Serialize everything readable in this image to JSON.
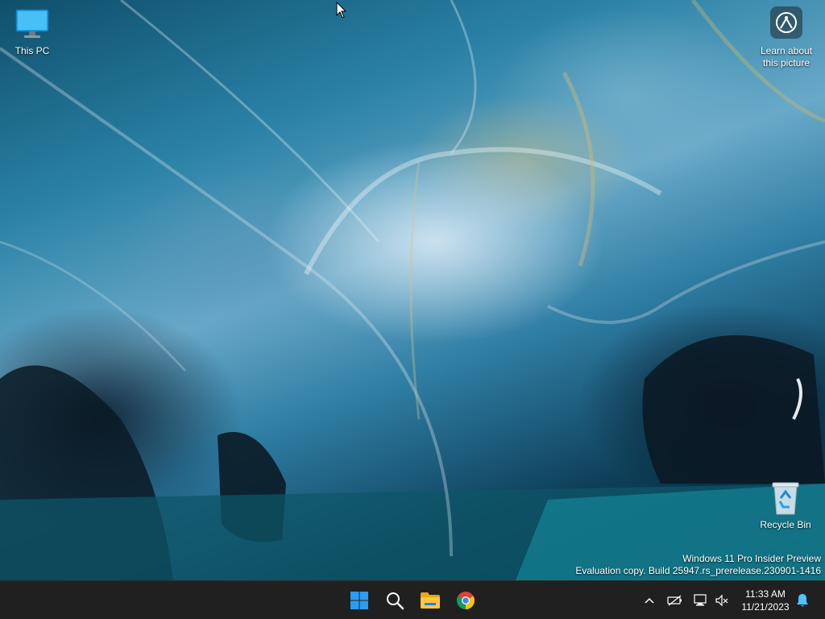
{
  "desktop": {
    "icons": [
      {
        "label": "This PC",
        "icon": "computer-monitor-icon"
      },
      {
        "label": "Learn about this picture",
        "icon": "learn-about-picture-icon"
      },
      {
        "label": "Recycle Bin",
        "icon": "recycle-bin-icon"
      }
    ],
    "watermark": {
      "line1": "Windows 11 Pro Insider Preview",
      "line2": "Evaluation copy. Build 25947.rs_prerelease.230901-1416"
    }
  },
  "taskbar": {
    "apps": [
      {
        "name": "Start",
        "icon": "windows-logo-icon"
      },
      {
        "name": "Search",
        "icon": "search-icon"
      },
      {
        "name": "File Explorer",
        "icon": "folder-icon"
      },
      {
        "name": "Google Chrome",
        "icon": "chrome-icon"
      }
    ],
    "tray": {
      "icons": [
        "chevron-up-icon",
        "battery-icon",
        "network-icon",
        "volume-muted-icon",
        "bell-icon"
      ],
      "time": "11:33 AM",
      "date": "11/21/2023"
    }
  },
  "colors": {
    "taskbar_bg": "#202020",
    "accent_blue": "#0078d4",
    "bell_blue": "#4cc2ff"
  }
}
